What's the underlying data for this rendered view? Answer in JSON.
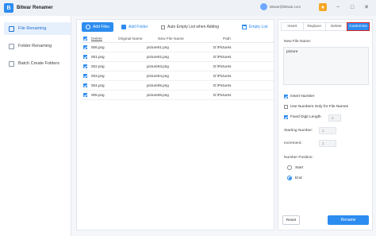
{
  "app": {
    "title": "Bitwar Renamer",
    "logo_letter": "B"
  },
  "titlebar": {
    "user_email": "Bitwar@Bitwar.com",
    "pro_badge": "★",
    "minimize": "−",
    "maximize": "□",
    "close": "✕"
  },
  "sidebar": {
    "items": [
      {
        "label": "File Renaming",
        "icon": "file-icon",
        "active": true
      },
      {
        "label": "Folder Renaming",
        "icon": "folder-icon",
        "active": false
      },
      {
        "label": "Batch Create Folders",
        "icon": "create-folder-icon",
        "active": false
      }
    ]
  },
  "toolbar": {
    "add_files": "Add Files",
    "add_folder": "Add Folder",
    "auto_empty": "Auto Empty List when Adding",
    "empty_list": "Empty List"
  },
  "table": {
    "headers": {
      "delete": "Delete",
      "original": "Original Name",
      "new_name": "New File Name",
      "path": "Path"
    },
    "rows": [
      {
        "orig": "006.png",
        "new": "picture01.png",
        "path": "D:\\Pictures"
      },
      {
        "orig": "001.png",
        "new": "picture02.png",
        "path": "D:\\Pictures"
      },
      {
        "orig": "002.png",
        "new": "picture03.png",
        "path": "D:\\Pictures"
      },
      {
        "orig": "003.png",
        "new": "picture04.png",
        "path": "D:\\Pictures"
      },
      {
        "orig": "004.png",
        "new": "picture05.png",
        "path": "D:\\Pictures"
      },
      {
        "orig": "005.png",
        "new": "picture06.png",
        "path": "D:\\Pictures"
      }
    ]
  },
  "panel": {
    "tabs": [
      {
        "label": "Insert",
        "active": false
      },
      {
        "label": "Replace",
        "active": false
      },
      {
        "label": "Delete",
        "active": false
      },
      {
        "label": "Customize",
        "active": true
      }
    ],
    "new_file_name_label": "New File Name:",
    "new_file_name_value": "picture",
    "insert_number": "Insert Number",
    "use_numbers_only": "Use Numbers Only for File Names",
    "fixed_digit_length": "Fixed Digit Length",
    "fixed_digit_value": "2",
    "starting_number_label": "Starting Number:",
    "starting_number_value": "1",
    "increment_label": "Increment:",
    "increment_value": "1",
    "number_position_label": "Number Position:",
    "position_start": "Start",
    "position_end": "End",
    "reset": "Reset",
    "rename": "Rename"
  },
  "colors": {
    "accent": "#2d8cf0",
    "highlight": "#e02020"
  }
}
